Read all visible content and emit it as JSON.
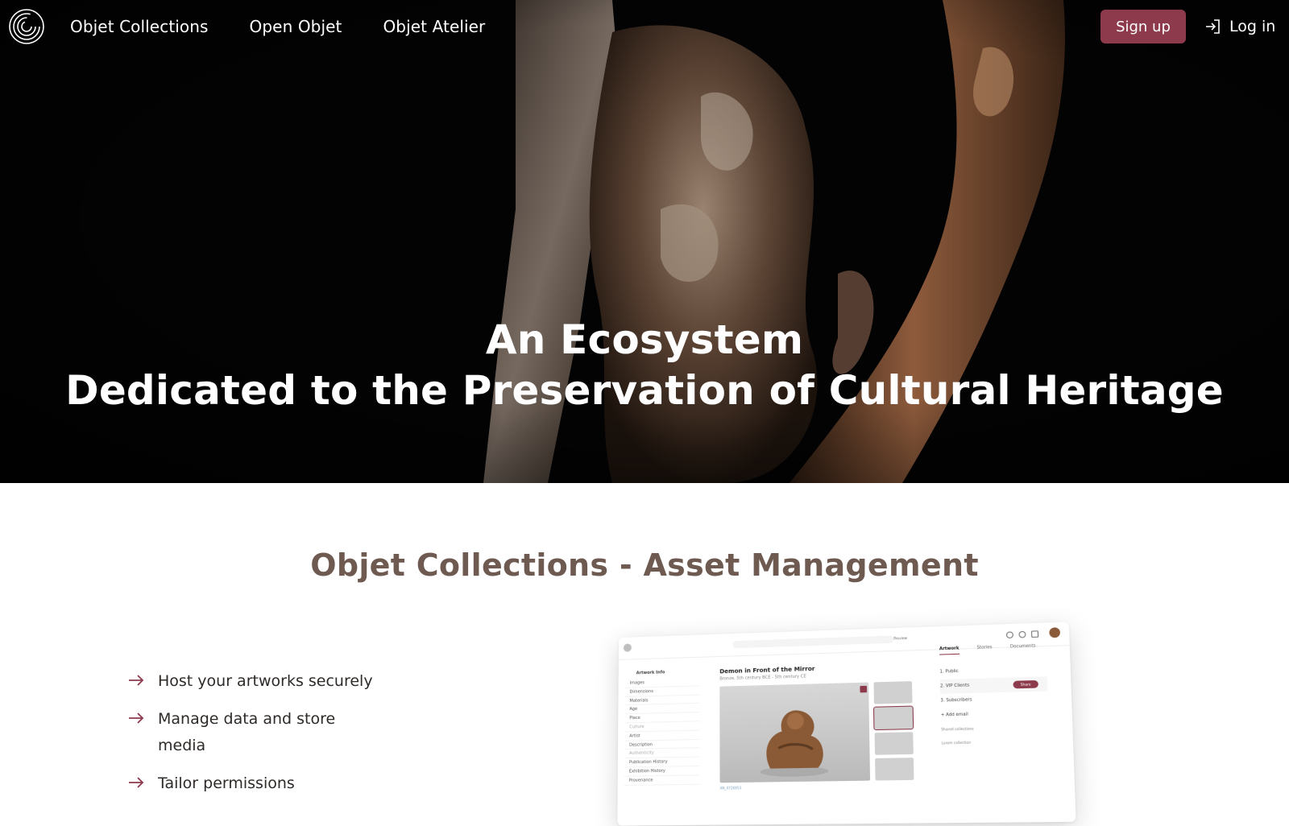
{
  "nav": {
    "links": [
      "Objet Collections",
      "Open Objet",
      "Objet Atelier"
    ],
    "signup_label": "Sign up",
    "login_label": "Log in"
  },
  "hero": {
    "title_line1": "An Ecosystem",
    "title_line2": "Dedicated to the Preservation of Cultural Heritage"
  },
  "section": {
    "title": "Objet Collections - Asset Management",
    "features": [
      "Host your artworks securely",
      "Manage data and store media",
      "Tailor permissions"
    ]
  },
  "mockup": {
    "side_head": "Artwork Info",
    "side_items": [
      "Images",
      "Dimensions",
      "Materials",
      "Age",
      "Place",
      "Culture",
      "Artist",
      "Description",
      "Authenticity",
      "Publication History",
      "Exhibition History",
      "Provenance"
    ],
    "title": "Demon in Front of the Mirror",
    "subtitle": "Bronze, 5th century BCE - 5th century CE",
    "preview_label": "Preview",
    "tabs": [
      "Artwork",
      "Stories",
      "Documents"
    ],
    "right_items": [
      "1. Public",
      "2. VIP Clients",
      "3. Subscribers",
      "+ Add email"
    ],
    "share_label": "Share",
    "right_small": [
      "Shared collections",
      "Lorem collection"
    ],
    "footer_id": "AN_0726953"
  },
  "colors": {
    "accent": "#8c3a4c",
    "section_title": "#6e5a50",
    "hero_bg": "#050404"
  }
}
